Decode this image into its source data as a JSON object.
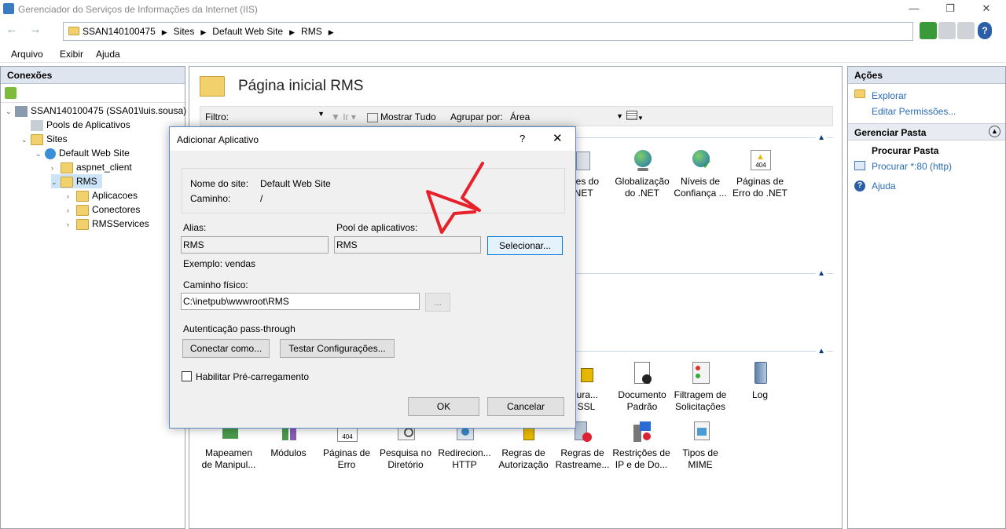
{
  "window": {
    "title": "Gerenciador do Serviços de Informações da Internet (IIS)",
    "min": "—",
    "max": "❐",
    "close": "✕"
  },
  "address": {
    "crumbs": [
      "SSAN140100475",
      "Sites",
      "Default Web Site",
      "RMS"
    ],
    "back": "←",
    "forward": "→"
  },
  "menu": [
    "Arquivo",
    "Exibir",
    "Ajuda"
  ],
  "connections": {
    "title": "Conexões",
    "tree": [
      {
        "label": "SSAN140100475 (SSA01\\luis.sousa)",
        "level": 0,
        "exp": "⌄",
        "icon": "server-icon"
      },
      {
        "label": "Pools de Aplicativos",
        "level": 1,
        "exp": "",
        "icon": "app-pools-icon"
      },
      {
        "label": "Sites",
        "level": 1,
        "exp": "⌄",
        "icon": "sites-icon"
      },
      {
        "label": "Default Web Site",
        "level": 2,
        "exp": "⌄",
        "icon": "globe-icon"
      },
      {
        "label": "aspnet_client",
        "level": 3,
        "exp": "›",
        "icon": "folder-icon"
      },
      {
        "label": "RMS",
        "level": 3,
        "exp": "⌄",
        "icon": "folder-icon",
        "selected": true
      },
      {
        "label": "Aplicacoes",
        "level": 4,
        "exp": "›",
        "icon": "folder-icon"
      },
      {
        "label": "Conectores",
        "level": 4,
        "exp": "›",
        "icon": "folder-icon"
      },
      {
        "label": "RMSServices",
        "level": 4,
        "exp": "›",
        "icon": "folder-icon"
      }
    ]
  },
  "center": {
    "title": "Página inicial RMS",
    "filter_label": "Filtro:",
    "go_label": "Ir",
    "show_all": "Mostrar Tudo",
    "group_by": "Agrupar por:",
    "group_value": "Área",
    "features_top": [
      {
        "l1": "ções do",
        "l2": ".NET"
      },
      {
        "l1": "Globalização",
        "l2": "do .NET"
      },
      {
        "l1": "Níveis de",
        "l2": "Confiança ..."
      },
      {
        "l1": "Páginas de",
        "l2": "Erro do .NET"
      }
    ],
    "features_mid": [
      {
        "l1": "figura...",
        "l2": "e SSL"
      },
      {
        "l1": "Documento",
        "l2": "Padrão"
      },
      {
        "l1": "Filtragem de",
        "l2": "Solicitações"
      },
      {
        "l1": "Log",
        "l2": ""
      }
    ],
    "features_bottom": [
      {
        "l1": "Mapeamen",
        "l2": "de Manipul..."
      },
      {
        "l1": "Módulos",
        "l2": ""
      },
      {
        "l1": "Páginas de",
        "l2": "Erro"
      },
      {
        "l1": "Pesquisa no",
        "l2": "Diretório"
      },
      {
        "l1": "Redirecion...",
        "l2": "HTTP"
      },
      {
        "l1": "Regras de",
        "l2": "Autorização"
      },
      {
        "l1": "Regras de",
        "l2": "Rastreame..."
      },
      {
        "l1": "Restrições de",
        "l2": "IP e de Do..."
      },
      {
        "l1": "Tipos de",
        "l2": "MIME"
      }
    ]
  },
  "actions": {
    "title": "Ações",
    "explore": "Explorar",
    "edit_perms": "Editar Permissões...",
    "manage_folder": "Gerenciar Pasta",
    "browse_head": "Procurar Pasta",
    "browse_link": "Procurar *:80 (http)",
    "help": "Ajuda"
  },
  "dialog": {
    "title": "Adicionar Aplicativo",
    "help": "?",
    "close": "✕",
    "site_name_label": "Nome do site:",
    "site_name_value": "Default Web Site",
    "path_label": "Caminho:",
    "path_value": "/",
    "alias_label": "Alias:",
    "alias_value": "RMS",
    "example": "Exemplo: vendas",
    "pool_label": "Pool de aplicativos:",
    "pool_value": "RMS",
    "select_btn": "Selecionar...",
    "physical_label": "Caminho físico:",
    "physical_value": "C:\\inetpub\\wwwroot\\RMS",
    "browse_btn": "...",
    "auth_label": "Autenticação pass-through",
    "connect_btn": "Conectar como...",
    "test_btn": "Testar Configurações...",
    "preload_label": "Habilitar Pré-carregamento",
    "ok": "OK",
    "cancel": "Cancelar"
  },
  "colors": {
    "annotation_arrow": "#e8202a",
    "accent": "#0078d7"
  }
}
